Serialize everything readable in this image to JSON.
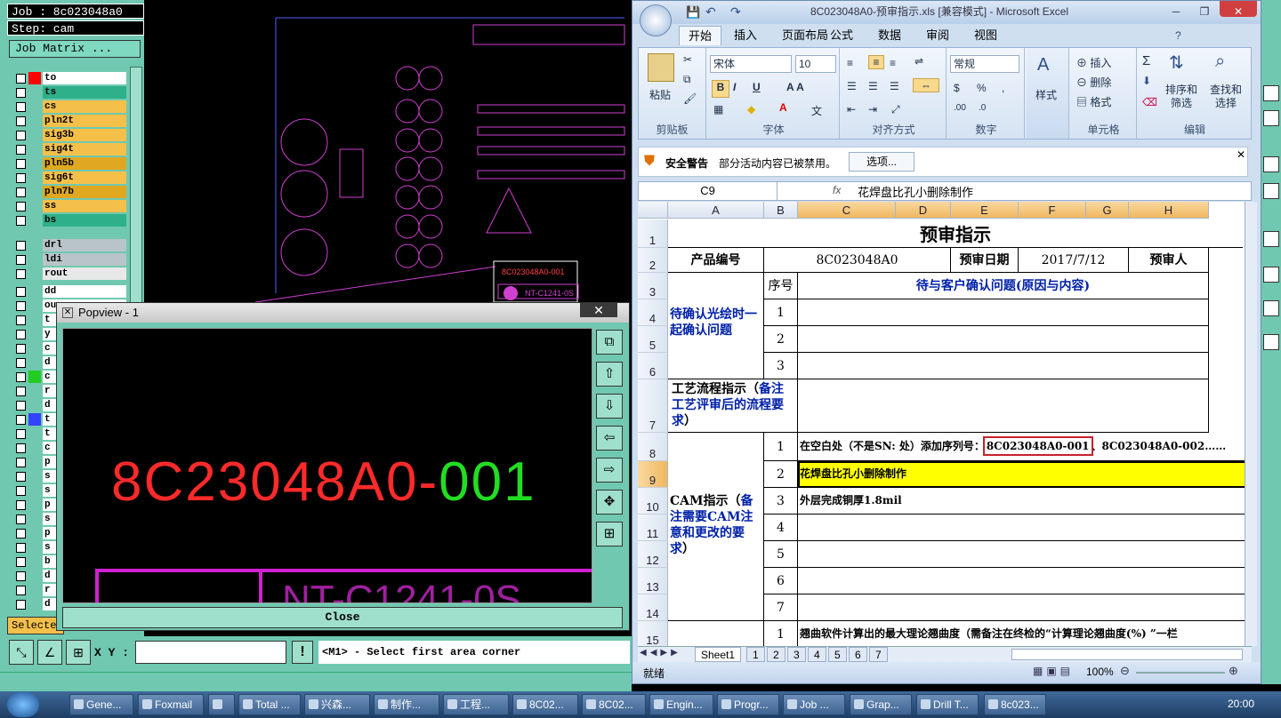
{
  "cam": {
    "job_label": "Job : 8c023048a0",
    "step_label": "Step: cam",
    "job_matrix": "Job Matrix ...",
    "layers_top": [
      {
        "name": "to",
        "color": "#ffffff",
        "swatch": "#ff0000"
      },
      {
        "name": "ts",
        "color": "#2eb08a",
        "swatch": ""
      },
      {
        "name": "cs",
        "color": "#f5c04a",
        "swatch": ""
      },
      {
        "name": "pln2t",
        "color": "#f5c04a",
        "swatch": ""
      },
      {
        "name": "sig3b",
        "color": "#f5c04a",
        "swatch": ""
      },
      {
        "name": "sig4t",
        "color": "#f5c04a",
        "swatch": ""
      },
      {
        "name": "pln5b",
        "color": "#e0a820",
        "swatch": ""
      },
      {
        "name": "sig6t",
        "color": "#f5c04a",
        "swatch": ""
      },
      {
        "name": "pln7b",
        "color": "#e0a820",
        "swatch": ""
      },
      {
        "name": "ss",
        "color": "#f5c04a",
        "swatch": ""
      },
      {
        "name": "bs",
        "color": "#2eb08a",
        "swatch": ""
      }
    ],
    "layers_drill": [
      {
        "name": "drl",
        "color": "#b8c4c8"
      },
      {
        "name": "ldi",
        "color": "#b8c4c8"
      },
      {
        "name": "rout",
        "color": "#e8e8e8"
      }
    ],
    "layers_misc": [
      {
        "name": "dd",
        "color": "#ffffff"
      },
      {
        "name": "ou",
        "color": "#ffffff"
      },
      {
        "name": "t",
        "color": "#ffffff"
      },
      {
        "name": "y",
        "color": "#ffffff"
      },
      {
        "name": "c",
        "color": "#ffffff"
      },
      {
        "name": "d",
        "color": "#ffffff"
      },
      {
        "name": "c",
        "color": "#ffffff",
        "swatch": "#22cc22"
      },
      {
        "name": "r",
        "color": "#ffffff"
      },
      {
        "name": "d",
        "color": "#ffffff"
      },
      {
        "name": "t",
        "color": "#ffffff",
        "swatch": "#3344ff"
      },
      {
        "name": "t",
        "color": "#ffffff"
      },
      {
        "name": "c",
        "color": "#ffffff"
      },
      {
        "name": "p",
        "color": "#ffffff"
      },
      {
        "name": "s",
        "color": "#ffffff"
      },
      {
        "name": "s",
        "color": "#ffffff"
      },
      {
        "name": "p",
        "color": "#ffffff"
      },
      {
        "name": "s",
        "color": "#ffffff"
      },
      {
        "name": "p",
        "color": "#ffffff"
      },
      {
        "name": "s",
        "color": "#ffffff"
      },
      {
        "name": "b",
        "color": "#ffffff"
      },
      {
        "name": "d",
        "color": "#ffffff"
      },
      {
        "name": "r",
        "color": "#ffffff"
      },
      {
        "name": "d",
        "color": "#ffffff"
      }
    ],
    "select_label": "Selecte",
    "canvas_label_red": "8C023048A0-001",
    "canvas_label_nt": "NT-C1241-0S",
    "xy_label": "X Y :",
    "status_text": "<M1> - Select first area corner",
    "excl": "!"
  },
  "popview": {
    "title": "Popview - 1",
    "close_x": "✕",
    "text_red": "8C23048A0-",
    "text_green": "001",
    "nt_text": "NT-C1241-0S",
    "close_button": "Close"
  },
  "excel": {
    "title": "8C023048A0-预审指示.xls  [兼容模式] - Microsoft Excel",
    "tabs": [
      "开始",
      "插入",
      "页面布局",
      "公式",
      "数据",
      "审阅",
      "视图"
    ],
    "ribbon": {
      "paste": "粘贴",
      "clipboard": "剪贴板",
      "font_name": "宋体",
      "font_size": "10",
      "font_group": "字体",
      "align_group": "对齐方式",
      "number_format": "常规",
      "number_group": "数字",
      "styles": "样式",
      "insert": "插入",
      "delete": "删除",
      "format": "格式",
      "cells_group": "单元格",
      "sort_filter": "排序和\n筛选",
      "find_select": "查找和\n选择",
      "edit_group": "编辑"
    },
    "warning": {
      "label": "安全警告",
      "text": "部分活动内容已被禁用。",
      "button": "选项..."
    },
    "name_box": "C9",
    "fx": "fx",
    "formula": "花焊盘比孔小删除制作",
    "columns": [
      "A",
      "B",
      "C",
      "D",
      "E",
      "F",
      "G",
      "H"
    ],
    "rows": [
      "1",
      "2",
      "3",
      "4",
      "5",
      "6",
      "7",
      "8",
      "9",
      "10",
      "11",
      "12",
      "13",
      "14",
      "15"
    ],
    "cells": {
      "r1_title": "预审指示",
      "r2_a": "产品编号",
      "r2_c": "8C023048A0",
      "r2_e": "预审日期",
      "r2_f": "2017/7/12",
      "r2_h": "预审人",
      "r3_b": "序号",
      "r3_c": "待与客户确认问题(原因与内容)",
      "r4_a": "待确认光绘时一起确认问题",
      "r4_b": "1",
      "r5_b": "2",
      "r6_b": "3",
      "r7_a_black": "工艺流程指示（",
      "r7_a_blue": "备注工艺评审后的流程要求",
      "r7_a_close": "）",
      "r8_b": "1",
      "r8_c_pre": "在空白处（不是SN: 处）添加序列号：",
      "r8_c_box": "8C023048A0-001",
      "r8_c_post": "、8C023048A0-002……",
      "r9_b": "2",
      "r9_c": "花焊盘比孔小删除制作",
      "r10_b": "3",
      "r10_c": "外层完成铜厚1.8mil",
      "r11_b": "4",
      "r12_b": "5",
      "r13_b": "6",
      "r14_b": "7",
      "r15_b": "1",
      "r15_c": "翘曲软件计算出的最大理论翘曲度（需备注在终检的“计算理论翘曲度(%) ”一栏",
      "cam_a_black": "CAM指示（",
      "cam_a_blue": "备注需要CAM注意和更改的要求",
      "cam_a_close": "）"
    },
    "sheets": [
      "Sheet1",
      "1",
      "2",
      "3",
      "4",
      "5",
      "6",
      "7"
    ],
    "status_ready": "就绪",
    "zoom": "100%"
  },
  "taskbar": {
    "items": [
      "Gene...",
      "Foxmail",
      "",
      "Total ...",
      "兴森...",
      "制作...",
      "工程...",
      "8C02...",
      "8C02...",
      "Engin...",
      "Progr...",
      "Job ...",
      "Grap...",
      "Drill T...",
      "8c023..."
    ],
    "clock": "20:00"
  }
}
